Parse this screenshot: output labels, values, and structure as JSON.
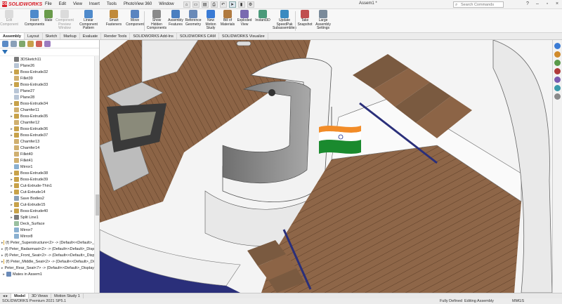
{
  "app": {
    "logo": "SOLIDWORKS",
    "document_title": "Assem1 *",
    "search_placeholder": "Search Commands"
  },
  "menu": [
    "File",
    "Edit",
    "View",
    "Insert",
    "Tools",
    "PhotoView 360",
    "Window"
  ],
  "ribbon": [
    {
      "label": "Edit\nComponent",
      "disabled": true
    },
    {
      "label": "Insert\nComponents",
      "disabled": false
    },
    {
      "label": "Mate",
      "disabled": false
    },
    {
      "label": "Component\nPreview\nWindow",
      "disabled": true
    },
    {
      "label": "Linear Component\nPattern",
      "disabled": false
    },
    {
      "label": "Smart\nFasteners",
      "disabled": false
    },
    {
      "label": "Move\nComponent",
      "disabled": false
    },
    {
      "label": "Show\nHidden\nComponents",
      "disabled": false
    },
    {
      "label": "Assembly\nFeatures",
      "disabled": false
    },
    {
      "label": "Reference\nGeometry",
      "disabled": false
    },
    {
      "label": "New\nMotion\nStudy",
      "disabled": false
    },
    {
      "label": "Bill of\nMaterials",
      "disabled": false
    },
    {
      "label": "Exploded\nView",
      "disabled": false
    },
    {
      "label": "Instant3D",
      "disabled": false
    },
    {
      "label": "Update\nSpeedPak\nSubassemblies",
      "disabled": false
    },
    {
      "label": "Take\nSnapshot",
      "disabled": false
    },
    {
      "label": "Large\nAssembly\nSettings",
      "disabled": false
    }
  ],
  "tabs": [
    "Assembly",
    "Layout",
    "Sketch",
    "Markup",
    "Evaluate",
    "Render Tools",
    "SOLIDWORKS Add-Ins",
    "SOLIDWORKS CAM",
    "SOLIDWORKS Visualize"
  ],
  "active_tab": "Assembly",
  "tree": [
    {
      "label": "3DSketch11",
      "icon": "sketch",
      "exp": ""
    },
    {
      "label": "Plane26",
      "icon": "plane",
      "exp": ""
    },
    {
      "label": "Boss-Extrude32",
      "icon": "feature",
      "exp": "▸"
    },
    {
      "label": "Fillet39",
      "icon": "fillet",
      "exp": ""
    },
    {
      "label": "Boss-Extrude33",
      "icon": "feature",
      "exp": "▸"
    },
    {
      "label": "Plane27",
      "icon": "plane",
      "exp": ""
    },
    {
      "label": "Plane28",
      "icon": "plane",
      "exp": ""
    },
    {
      "label": "Boss-Extrude34",
      "icon": "feature",
      "exp": "▸"
    },
    {
      "label": "Chamfer11",
      "icon": "fillet",
      "exp": ""
    },
    {
      "label": "Boss-Extrude35",
      "icon": "feature",
      "exp": "▸"
    },
    {
      "label": "Chamfer12",
      "icon": "fillet",
      "exp": ""
    },
    {
      "label": "Boss-Extrude36",
      "icon": "feature",
      "exp": "▸"
    },
    {
      "label": "Boss-Extrude37",
      "icon": "feature",
      "exp": "▸"
    },
    {
      "label": "Chamfer13",
      "icon": "fillet",
      "exp": ""
    },
    {
      "label": "Chamfer14",
      "icon": "fillet",
      "exp": ""
    },
    {
      "label": "Fillet40",
      "icon": "fillet",
      "exp": ""
    },
    {
      "label": "Fillet41",
      "icon": "fillet",
      "exp": ""
    },
    {
      "label": "Mirror1",
      "icon": "mirror",
      "exp": ""
    },
    {
      "label": "Boss-Extrude38",
      "icon": "feature",
      "exp": "▸"
    },
    {
      "label": "Boss-Extrude39",
      "icon": "feature",
      "exp": "▸"
    },
    {
      "label": "Cut-Extrude-Thin1",
      "icon": "feature",
      "exp": "▸"
    },
    {
      "label": "Cut-Extrude14",
      "icon": "feature",
      "exp": "▸"
    },
    {
      "label": "Save Bodies2",
      "icon": "body",
      "exp": ""
    },
    {
      "label": "Cut-Extrude15",
      "icon": "feature",
      "exp": "▸"
    },
    {
      "label": "Boss-Extrude40",
      "icon": "feature",
      "exp": "▸"
    },
    {
      "label": "Split Line1",
      "icon": "sketch",
      "exp": "▸"
    },
    {
      "label": "Deck_Surface",
      "icon": "surface",
      "exp": ""
    },
    {
      "label": "Mirror7",
      "icon": "mirror",
      "exp": ""
    },
    {
      "label": "Mirror8",
      "icon": "mirror",
      "exp": ""
    },
    {
      "label": "(f) Peter_Superstructure<2> -> (Default<<Default>_",
      "icon": "part",
      "exp": "▸",
      "top": true
    },
    {
      "label": "(f) Peter_Radarmast<2> -> (Default<<Default>_Disp",
      "icon": "part",
      "exp": "▸",
      "top": true
    },
    {
      "label": "(f) Peter_Front_Seat<2> -> (Default<<Default>_Disp",
      "icon": "part",
      "exp": "▸",
      "top": true
    },
    {
      "label": "(f) Peter_Middle_Seat<2> -> (Default<<Default>_Di",
      "icon": "part",
      "exp": "▸",
      "top": true
    },
    {
      "label": "Peter_Rear_Seat<7> -> (Default<<Default>_Display",
      "icon": "part",
      "exp": "▸",
      "top": true
    },
    {
      "label": "Mates in Assem1",
      "icon": "mates",
      "exp": "▸",
      "top": true
    }
  ],
  "bottom_tabs": [
    "Model",
    "3D Views",
    "Motion Study 1"
  ],
  "status": {
    "left": "SOLIDWORKS Premium 2021 SP5.1",
    "fully_defined": "Fully Defined",
    "mode": "Editing Assembly",
    "units": "MMGS"
  },
  "colors": {
    "brand": "#d8202a",
    "deck": "#8c6446",
    "hull": "#f0f0f0",
    "navy": "#2a2f7a",
    "accent": "#2a6fb5"
  }
}
